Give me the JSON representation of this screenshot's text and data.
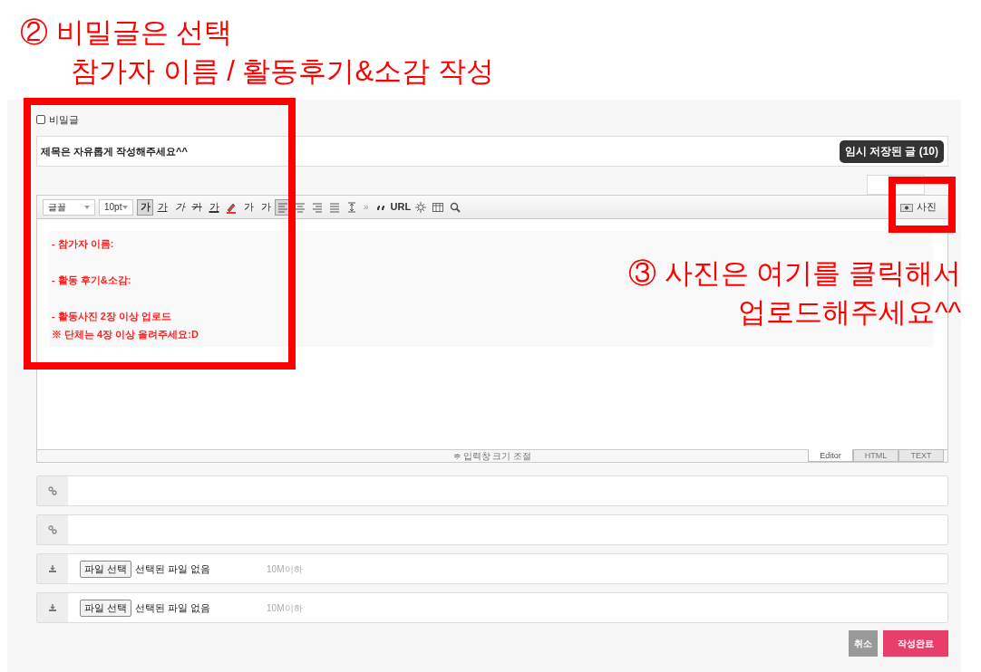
{
  "annotations": [
    {
      "lines": [
        "② 비밀글은 선택",
        "참가자 이름 / 활동후기&소감 작성"
      ]
    },
    {
      "lines": [
        "③ 사진은 여기를 클릭해서",
        "업로드해주세요^^"
      ]
    }
  ],
  "secret": {
    "label": "비밀글",
    "checked": false
  },
  "title_field": {
    "value": "제목은 자유롭게 작성해주세요^^",
    "drafts_button": "임시 저장된 글 (10)"
  },
  "toolbar": [
    {
      "kind": "select",
      "label": "글꼴"
    },
    {
      "kind": "select",
      "label": "10pt"
    },
    {
      "kind": "text",
      "label": "가",
      "pressed": true
    },
    {
      "kind": "text",
      "label": "가",
      "pressed": false
    },
    {
      "kind": "text",
      "label": "가",
      "pressed": false
    },
    {
      "kind": "text",
      "label": "가",
      "pressed": false
    },
    {
      "kind": "text",
      "label": "가",
      "pressed": false
    },
    {
      "kind": "icon",
      "pressed": false
    },
    {
      "kind": "text",
      "label": "가",
      "pressed": false
    },
    {
      "kind": "text",
      "label": "가",
      "pressed": false
    },
    {
      "kind": "icon",
      "pressed": true
    },
    {
      "kind": "icon",
      "pressed": false
    },
    {
      "kind": "icon",
      "pressed": false
    },
    {
      "kind": "icon",
      "pressed": false
    },
    {
      "kind": "icon",
      "pressed": false
    },
    {
      "kind": "more",
      "label": "»"
    },
    {
      "kind": "icon",
      "pressed": false
    },
    {
      "kind": "text",
      "label": "URL",
      "pressed": false
    },
    {
      "kind": "icon",
      "pressed": false
    },
    {
      "kind": "icon",
      "pressed": false
    },
    {
      "kind": "icon",
      "pressed": false
    }
  ],
  "photo_button": "사진",
  "body_paragraphs": [
    [
      "- 참가자 이름:"
    ],
    [
      "- 활동 후기&소감:"
    ],
    [
      "- 활동사진 2장 이상 업로드",
      "※ 단체는 4장 이상 올려주세요:D"
    ]
  ],
  "resize_label": "≑ 입력창 크기 조절",
  "mode_tabs": [
    {
      "label": "Editor",
      "selected": true
    },
    {
      "label": "HTML",
      "selected": false
    },
    {
      "label": "TEXT",
      "selected": false
    }
  ],
  "attachments": [
    {
      "kind": "link"
    },
    {
      "kind": "link"
    },
    {
      "kind": "file",
      "button": "파일 선택",
      "status": "선택된 파일 없음",
      "limit": "10M이하"
    },
    {
      "kind": "file",
      "button": "파일 선택",
      "status": "선택된 파일 없음",
      "limit": "10M이하"
    }
  ],
  "actions": [
    {
      "kind": "cancel",
      "label": "취소"
    },
    {
      "kind": "submit",
      "label": "작성완료"
    }
  ]
}
